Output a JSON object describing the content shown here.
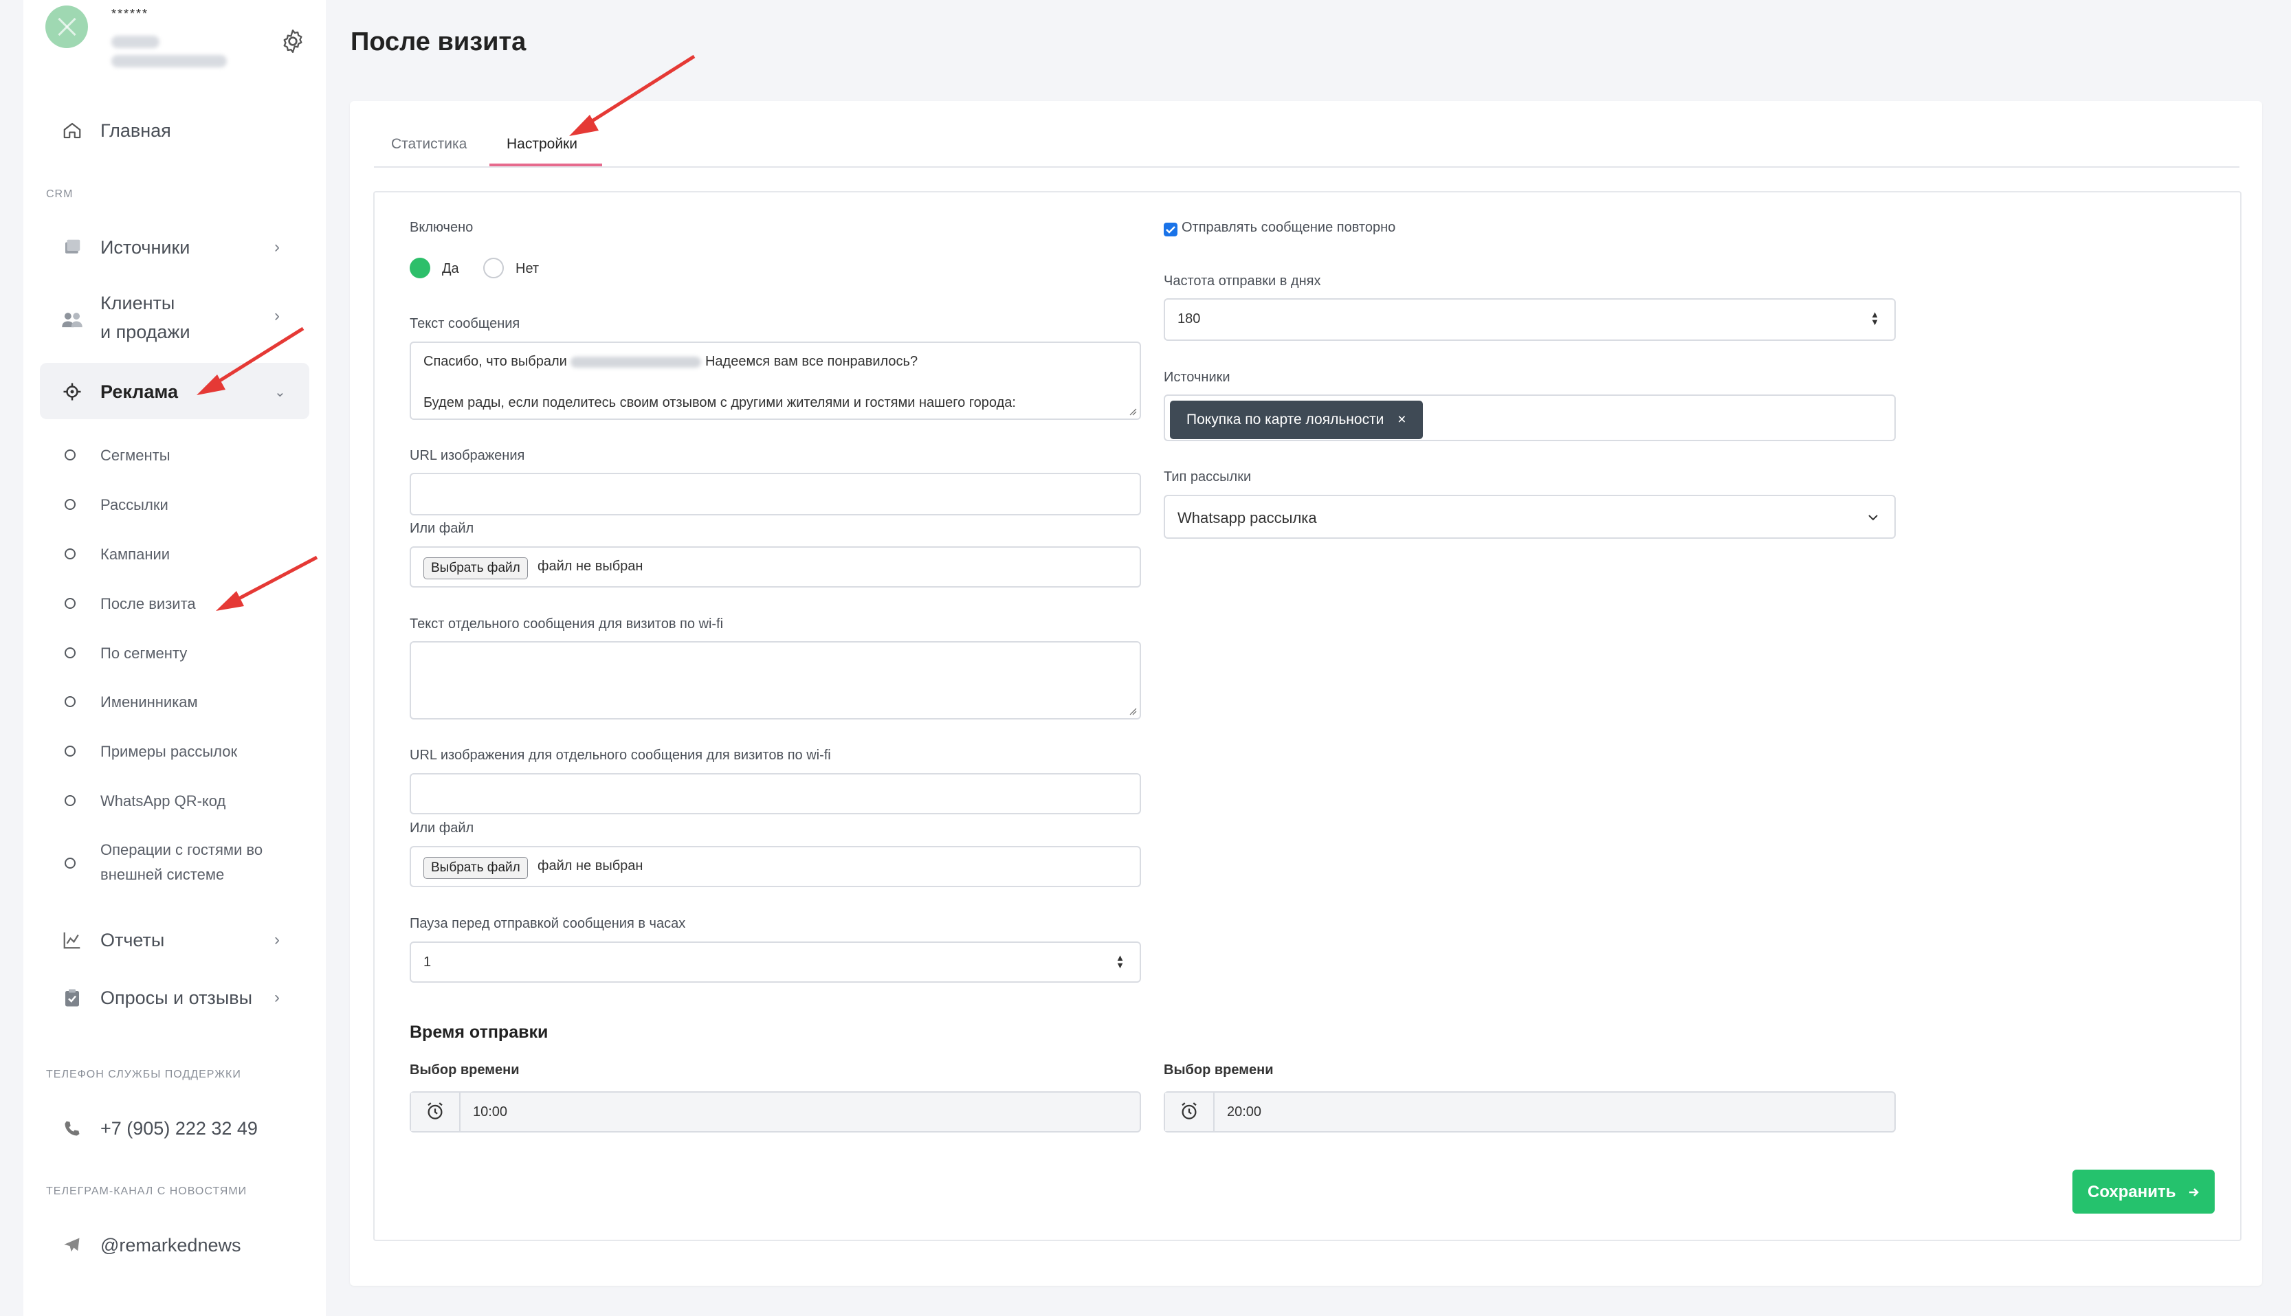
{
  "sidebar": {
    "user_name": "******",
    "nav": {
      "home": "Главная",
      "crm_label": "CRM",
      "sources": "Источники",
      "clients_line1": "Клиенты",
      "clients_line2": "и продажи",
      "ads": "Реклама",
      "sub": [
        "Сегменты",
        "Рассылки",
        "Кампании",
        "После визита",
        "По сегменту",
        "Именинникам",
        "Примеры рассылок",
        "WhatsApp QR-код"
      ],
      "ops_line1": "Операции с гостями во",
      "ops_line2": "внешней системе",
      "reports": "Отчеты",
      "surveys": "Опросы и отзывы"
    },
    "support_label": "ТЕЛЕФОН СЛУЖБЫ ПОДДЕРЖКИ",
    "support_phone": "+7 (905) 222 32 49",
    "telegram_label": "ТЕЛЕГРАМ-КАНАЛ С НОВОСТЯМИ",
    "telegram_handle": "@remarkednews"
  },
  "page": {
    "title": "После визита"
  },
  "tabs": {
    "stats": "Статистика",
    "settings": "Настройки"
  },
  "form": {
    "enabled_label": "Включено",
    "yes": "Да",
    "no": "Нет",
    "message_label": "Текст сообщения",
    "message_line1_a": "Спасибо, что выбрали",
    "message_line1_b": "Надеемся вам все понравилось?",
    "message_line2": "Будем рады, если поделитесь своим отзывом с другими жителями и гостями нашего города:",
    "image_url_label": "URL изображения",
    "or_file_label": "Или файл",
    "choose_file": "Выбрать файл",
    "no_file": "файл не выбран",
    "wifi_text_label": "Текст отдельного сообщения для визитов по wi-fi",
    "wifi_image_label": "URL изображения для отдельного сообщения для визитов по wi-fi",
    "pause_label": "Пауза перед отправкой сообщения в часах",
    "pause_value": "1",
    "send_time_heading": "Время отправки",
    "time_from_label": "Выбор времени",
    "time_from_value": "10:00",
    "time_to_label": "Выбор времени",
    "time_to_value": "20:00",
    "resend_label": "Отправлять сообщение повторно",
    "frequency_label": "Частота отправки в днях",
    "frequency_value": "180",
    "sources_label": "Источники",
    "source_tag": "Покупка по карте лояльности",
    "tag_remove": "×",
    "mailing_type_label": "Тип рассылки",
    "mailing_type_value": "Whatsapp рассылка",
    "save": "Сохранить"
  },
  "colors": {
    "accent_green": "#25c26d",
    "tab_underline": "#e66a8d",
    "arrow_red": "#e53935"
  }
}
